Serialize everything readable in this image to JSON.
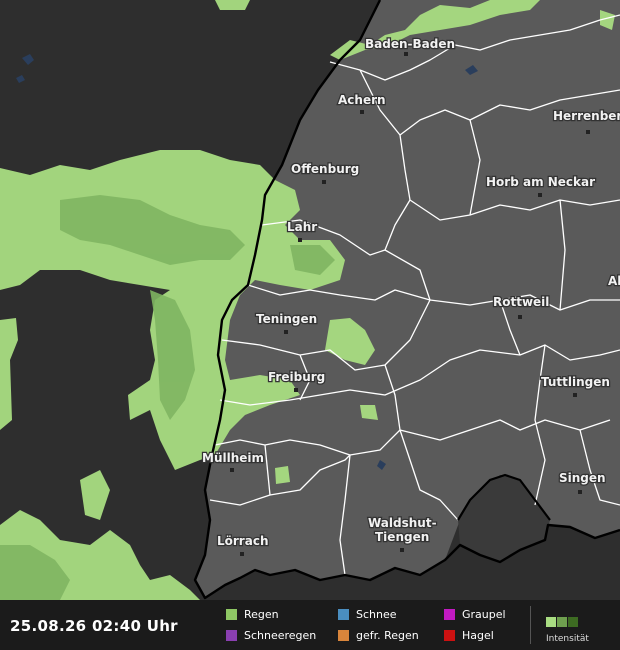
{
  "timestamp": "25.08.26 02:40 Uhr",
  "colors": {
    "background_outside": "#2e2e2e",
    "land": "#5a5a5a",
    "border_country": "#000000",
    "border_district": "#ffffff",
    "rain_light": "#a9dd82",
    "rain_medium": "#7fb562"
  },
  "cities": [
    {
      "name": "Baden-Baden"
    },
    {
      "name": "Achern"
    },
    {
      "name": "Herrenberg"
    },
    {
      "name": "Offenburg"
    },
    {
      "name": "Horb am Neckar"
    },
    {
      "name": "Lahr"
    },
    {
      "name": "Rottweil"
    },
    {
      "name": "Al"
    },
    {
      "name": "Teningen"
    },
    {
      "name": "Freiburg"
    },
    {
      "name": "Tuttlingen"
    },
    {
      "name": "Müllheim"
    },
    {
      "name": "Singen"
    },
    {
      "name": "Waldshut-"
    },
    {
      "name": "Tiengen"
    },
    {
      "name": "Lörrach"
    }
  ],
  "legend": {
    "items": [
      {
        "label": "Regen",
        "color": "#8ec764"
      },
      {
        "label": "Schnee",
        "color": "#4a8ec0"
      },
      {
        "label": "Graupel",
        "color": "#c21ac2"
      },
      {
        "label": "Schneeregen",
        "color": "#8a3fb0"
      },
      {
        "label": "gefr. Regen",
        "color": "#d9853b"
      },
      {
        "label": "Hagel",
        "color": "#cc1111"
      }
    ],
    "intensity_label": "Intensität",
    "intensity_colors": [
      "#a9dd82",
      "#6fa04f",
      "#3d6b22"
    ]
  }
}
